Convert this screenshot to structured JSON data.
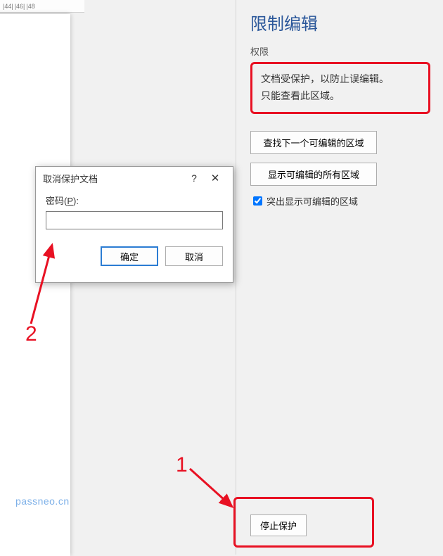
{
  "ruler": {
    "marks": [
      "|44|",
      "|46|",
      "|48"
    ]
  },
  "panel": {
    "title": "限制编辑",
    "section_label": "权限",
    "info_line1": "文档受保护，以防止误编辑。",
    "info_line2": "只能查看此区域。",
    "btn_find_next": "查找下一个可编辑的区域",
    "btn_show_all": "显示可编辑的所有区域",
    "checkbox_label": "突出显示可编辑的区域",
    "checkbox_checked": true,
    "stop_protection": "停止保护"
  },
  "dialog": {
    "title": "取消保护文档",
    "help": "?",
    "close": "✕",
    "password_label_prefix": "密码(",
    "password_label_key": "P",
    "password_label_suffix": "):",
    "password_value": "",
    "ok": "确定",
    "cancel": "取消"
  },
  "annotations": {
    "num1": "1",
    "num2": "2"
  },
  "watermark": "passneo.cn",
  "colors": {
    "accent": "#2b579a",
    "highlight": "#e81123"
  }
}
